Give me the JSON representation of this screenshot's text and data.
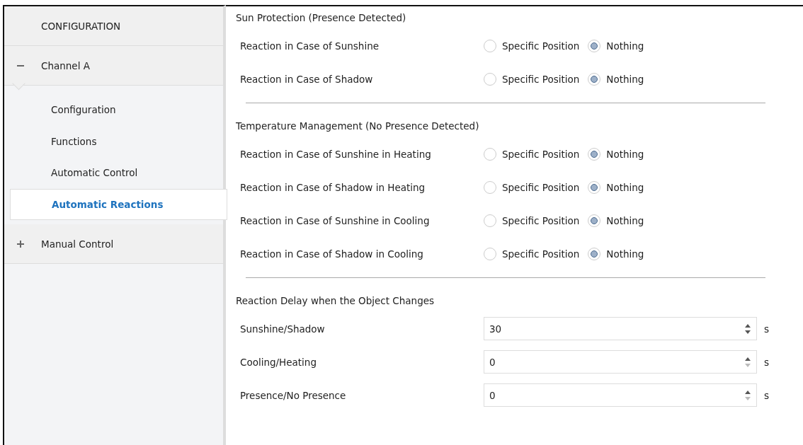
{
  "sidebar": {
    "header": "CONFIGURATION",
    "groups": [
      {
        "label": "Channel A",
        "expanded": true,
        "children": [
          {
            "label": "Configuration",
            "selected": false
          },
          {
            "label": "Functions",
            "selected": false
          },
          {
            "label": "Automatic Control",
            "selected": false
          },
          {
            "label": "Automatic Reactions",
            "selected": true
          }
        ]
      },
      {
        "label": "Manual Control",
        "expanded": false
      }
    ]
  },
  "sections": [
    {
      "title": "Sun Protection (Presence Detected)",
      "rows": [
        {
          "kind": "radio",
          "label": "Reaction in Case of Sunshine",
          "options": [
            {
              "label": "Specific Position",
              "selected": false
            },
            {
              "label": "Nothing",
              "selected": true
            }
          ]
        },
        {
          "kind": "radio",
          "label": "Reaction in Case of Shadow",
          "options": [
            {
              "label": "Specific Position",
              "selected": false
            },
            {
              "label": "Nothing",
              "selected": true
            }
          ]
        }
      ]
    },
    {
      "title": "Temperature Management (No Presence Detected)",
      "rows": [
        {
          "kind": "radio",
          "label": "Reaction in Case of Sunshine in Heating",
          "options": [
            {
              "label": "Specific Position",
              "selected": false
            },
            {
              "label": "Nothing",
              "selected": true
            }
          ]
        },
        {
          "kind": "radio",
          "label": "Reaction in Case of Shadow in Heating",
          "options": [
            {
              "label": "Specific Position",
              "selected": false
            },
            {
              "label": "Nothing",
              "selected": true
            }
          ]
        },
        {
          "kind": "radio",
          "label": "Reaction in Case of Sunshine in Cooling",
          "options": [
            {
              "label": "Specific Position",
              "selected": false
            },
            {
              "label": "Nothing",
              "selected": true
            }
          ]
        },
        {
          "kind": "radio",
          "label": "Reaction in Case of Shadow in Cooling",
          "options": [
            {
              "label": "Specific Position",
              "selected": false
            },
            {
              "label": "Nothing",
              "selected": true
            }
          ]
        }
      ]
    },
    {
      "title": "Reaction Delay when the Object Changes",
      "rows": [
        {
          "kind": "number",
          "label": "Sunshine/Shadow",
          "value": "30",
          "unit": "s",
          "decrement_disabled": false
        },
        {
          "kind": "number",
          "label": "Cooling/Heating",
          "value": "0",
          "unit": "s",
          "decrement_disabled": true
        },
        {
          "kind": "number",
          "label": "Presence/No Presence",
          "value": "0",
          "unit": "s",
          "decrement_disabled": true
        }
      ]
    }
  ]
}
